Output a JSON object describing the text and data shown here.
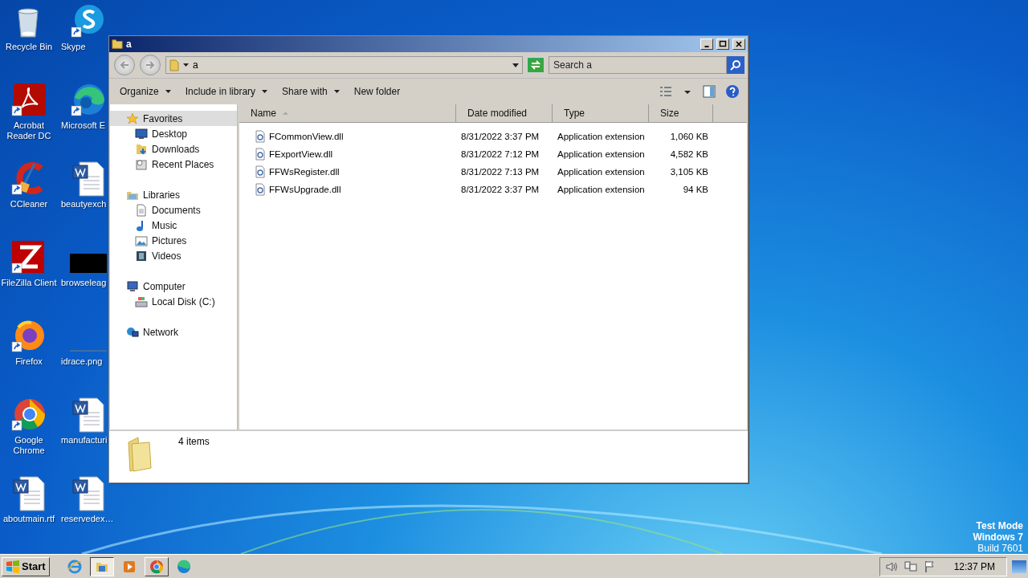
{
  "desktop_icons": [
    {
      "label": "Recycle Bin",
      "kind": "recycle",
      "shortcut": false
    },
    {
      "label": "Acrobat Reader DC",
      "kind": "pdf",
      "shortcut": true
    },
    {
      "label": "CCleaner",
      "kind": "cleaner",
      "shortcut": true
    },
    {
      "label": "FileZilla Client",
      "kind": "ftp",
      "shortcut": true
    },
    {
      "label": "Firefox",
      "kind": "firefox",
      "shortcut": true
    },
    {
      "label": "Google Chrome",
      "kind": "chrome",
      "shortcut": true
    },
    {
      "label": "aboutmain.rtf",
      "kind": "document",
      "shortcut": false
    },
    {
      "label": "Skype",
      "kind": "chat",
      "shortcut": true
    },
    {
      "label": "Microsoft E",
      "kind": "edge",
      "shortcut": true
    },
    {
      "label": "beautyexch",
      "kind": "document",
      "shortcut": false
    },
    {
      "label": "browseleag",
      "kind": "dark-image",
      "shortcut": false
    },
    {
      "label": "idrace.png",
      "kind": "line-image",
      "shortcut": false
    },
    {
      "label": "manufacturi",
      "kind": "document",
      "shortcut": false
    },
    {
      "label": "reservedex…",
      "kind": "document",
      "shortcut": false
    }
  ],
  "window": {
    "title": "a",
    "address": "a",
    "search": {
      "placeholder": "Search a"
    },
    "toolbar": [
      {
        "label": "Organize",
        "dropdown": true
      },
      {
        "label": "Include in library",
        "dropdown": true
      },
      {
        "label": "Share with",
        "dropdown": true
      },
      {
        "label": "New folder",
        "dropdown": false
      }
    ],
    "nav": [
      {
        "label": "Favorites",
        "kind": "star",
        "selected": true,
        "children": [
          {
            "label": "Desktop",
            "kind": "desktop",
            "selected": false
          },
          {
            "label": "Downloads",
            "kind": "downloads",
            "selected": false
          },
          {
            "label": "Recent Places",
            "kind": "recent",
            "selected": false
          }
        ]
      },
      {
        "label": "Libraries",
        "kind": "libraries",
        "selected": false,
        "children": [
          {
            "label": "Documents",
            "kind": "documents",
            "selected": false
          },
          {
            "label": "Music",
            "kind": "music",
            "selected": false
          },
          {
            "label": "Pictures",
            "kind": "pictures",
            "selected": false
          },
          {
            "label": "Videos",
            "kind": "videos",
            "selected": false
          }
        ]
      },
      {
        "label": "Computer",
        "kind": "computer",
        "selected": false,
        "children": [
          {
            "label": "Local Disk (C:)",
            "kind": "disk",
            "selected": false
          }
        ]
      },
      {
        "label": "Network",
        "kind": "network",
        "selected": false
      }
    ],
    "columns": [
      {
        "label": "Name",
        "sorted": true
      },
      {
        "label": "Date modified",
        "sorted": false
      },
      {
        "label": "Type",
        "sorted": false
      },
      {
        "label": "Size",
        "sorted": false
      }
    ],
    "rows": [
      {
        "name": "FCommonView.dll",
        "date": "8/31/2022 3:37 PM",
        "type": "Application extension",
        "size": "1,060 KB"
      },
      {
        "name": "FExportView.dll",
        "date": "8/31/2022 7:12 PM",
        "type": "Application extension",
        "size": "4,582 KB"
      },
      {
        "name": "FFWsRegister.dll",
        "date": "8/31/2022 7:13 PM",
        "type": "Application extension",
        "size": "3,105 KB"
      },
      {
        "name": "FFWsUpgrade.dll",
        "date": "8/31/2022 3:37 PM",
        "type": "Application extension",
        "size": "94 KB"
      }
    ],
    "status": "4 items"
  },
  "os_notice": [
    "Test Mode",
    "Windows 7",
    "Build 7601"
  ],
  "taskbar": {
    "start": "Start",
    "apps": [
      {
        "kind": "ie",
        "running": false,
        "active": false
      },
      {
        "kind": "explorer",
        "running": true,
        "active": true
      },
      {
        "kind": "media",
        "running": false,
        "active": false
      },
      {
        "kind": "chrome",
        "running": true,
        "active": false
      },
      {
        "kind": "edge",
        "running": false,
        "active": false
      }
    ],
    "clock": "12:37 PM"
  }
}
